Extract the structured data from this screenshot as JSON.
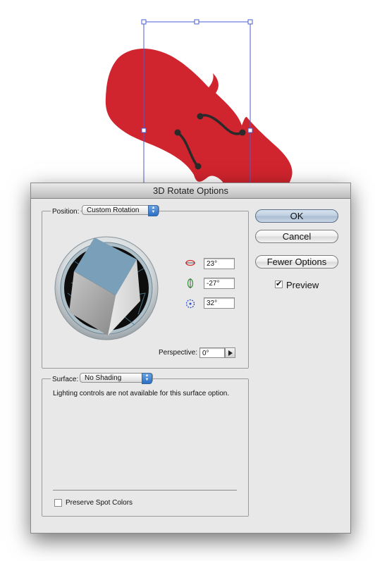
{
  "dialog": {
    "title": "3D Rotate Options",
    "position": {
      "label": "Position:",
      "value": "Custom Rotation"
    },
    "rotation": {
      "x": "23°",
      "y": "-27°",
      "z": "32°"
    },
    "perspective": {
      "label": "Perspective:",
      "value": "0°"
    },
    "surface": {
      "label": "Surface:",
      "value": "No Shading",
      "message": "Lighting controls are not available for this surface option."
    },
    "preserve_spot_colors": {
      "label": "Preserve Spot Colors",
      "checked": false
    },
    "buttons": {
      "ok": "OK",
      "cancel": "Cancel",
      "fewer_options": "Fewer Options"
    },
    "preview": {
      "label": "Preview",
      "checked": true,
      "mark": "✔"
    }
  },
  "colors": {
    "violin": "#d0242e",
    "selection": "#4a5fd0",
    "cube_top": "#7a9fb8",
    "ok_button": "#bfcfe0"
  },
  "icons": [
    "x-axis-rotate-icon",
    "y-axis-rotate-icon",
    "z-axis-rotate-icon",
    "popup-arrows-icon",
    "play-triangle-icon"
  ]
}
